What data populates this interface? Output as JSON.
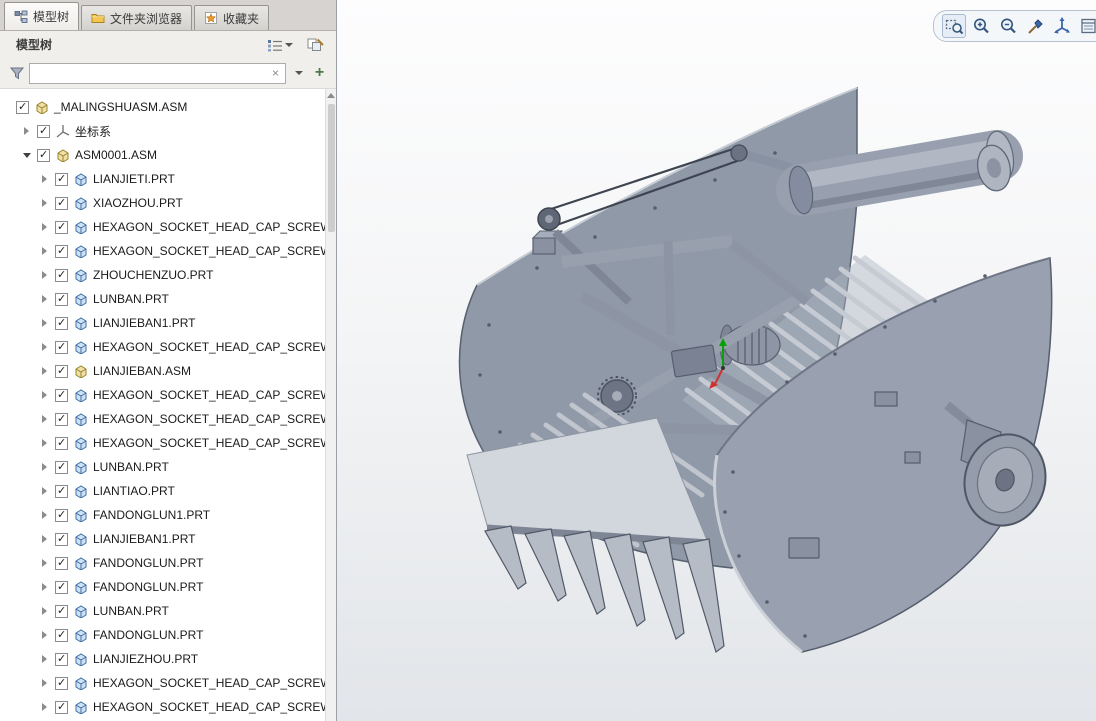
{
  "tabs": [
    {
      "label": "模型树",
      "icon": "model-tree-icon",
      "active": true
    },
    {
      "label": "文件夹浏览器",
      "icon": "folder-browser-icon",
      "active": false
    },
    {
      "label": "收藏夹",
      "icon": "favorites-icon",
      "active": false
    }
  ],
  "panel": {
    "title": "模型树",
    "icons": [
      "list-options-icon",
      "tree-settings-icon"
    ]
  },
  "filter": {
    "search_value": "",
    "placeholder": "",
    "clear_glyph": "×",
    "add_glyph": "+",
    "icons": [
      "filter-funnel-icon",
      "dropdown-caret-icon",
      "add-filter-icon"
    ]
  },
  "tree": {
    "items": [
      {
        "level": 0,
        "expander": "none",
        "checked": true,
        "icon": "asm",
        "label": "_MALINGSHUASM.ASM"
      },
      {
        "level": 1,
        "expander": "right",
        "checked": true,
        "icon": "coord",
        "label": "坐标系"
      },
      {
        "level": 1,
        "expander": "down",
        "checked": true,
        "icon": "asm",
        "label": "ASM0001.ASM"
      },
      {
        "level": 2,
        "expander": "right",
        "checked": true,
        "icon": "prt",
        "label": "LIANJIETI.PRT"
      },
      {
        "level": 2,
        "expander": "right",
        "checked": true,
        "icon": "prt",
        "label": "XIAOZHOU.PRT"
      },
      {
        "level": 2,
        "expander": "right",
        "checked": true,
        "icon": "prt",
        "label": "HEXAGON_SOCKET_HEAD_CAP_SCREW"
      },
      {
        "level": 2,
        "expander": "right",
        "checked": true,
        "icon": "prt",
        "label": "HEXAGON_SOCKET_HEAD_CAP_SCREW"
      },
      {
        "level": 2,
        "expander": "right",
        "checked": true,
        "icon": "prt",
        "label": "ZHOUCHENZUO.PRT"
      },
      {
        "level": 2,
        "expander": "right",
        "checked": true,
        "icon": "prt",
        "label": "LUNBAN.PRT"
      },
      {
        "level": 2,
        "expander": "right",
        "checked": true,
        "icon": "prt",
        "label": "LIANJIEBAN1.PRT"
      },
      {
        "level": 2,
        "expander": "right",
        "checked": true,
        "icon": "prt",
        "label": "HEXAGON_SOCKET_HEAD_CAP_SCREW"
      },
      {
        "level": 2,
        "expander": "right",
        "checked": true,
        "icon": "asm",
        "label": "LIANJIEBAN.ASM"
      },
      {
        "level": 2,
        "expander": "right",
        "checked": true,
        "icon": "prt",
        "label": "HEXAGON_SOCKET_HEAD_CAP_SCREW"
      },
      {
        "level": 2,
        "expander": "right",
        "checked": true,
        "icon": "prt",
        "label": "HEXAGON_SOCKET_HEAD_CAP_SCREW"
      },
      {
        "level": 2,
        "expander": "right",
        "checked": true,
        "icon": "prt",
        "label": "HEXAGON_SOCKET_HEAD_CAP_SCREW"
      },
      {
        "level": 2,
        "expander": "right",
        "checked": true,
        "icon": "prt",
        "label": "LUNBAN.PRT"
      },
      {
        "level": 2,
        "expander": "right",
        "checked": true,
        "icon": "prt",
        "label": "LIANTIAO.PRT"
      },
      {
        "level": 2,
        "expander": "right",
        "checked": true,
        "icon": "prt",
        "label": "FANDONGLUN1.PRT"
      },
      {
        "level": 2,
        "expander": "right",
        "checked": true,
        "icon": "prt",
        "label": "LIANJIEBAN1.PRT"
      },
      {
        "level": 2,
        "expander": "right",
        "checked": true,
        "icon": "prt",
        "label": "FANDONGLUN.PRT"
      },
      {
        "level": 2,
        "expander": "right",
        "checked": true,
        "icon": "prt",
        "label": "FANDONGLUN.PRT"
      },
      {
        "level": 2,
        "expander": "right",
        "checked": true,
        "icon": "prt",
        "label": "LUNBAN.PRT"
      },
      {
        "level": 2,
        "expander": "right",
        "checked": true,
        "icon": "prt",
        "label": "FANDONGLUN.PRT"
      },
      {
        "level": 2,
        "expander": "right",
        "checked": true,
        "icon": "prt",
        "label": "LIANJIEZHOU.PRT"
      },
      {
        "level": 2,
        "expander": "right",
        "checked": true,
        "icon": "prt",
        "label": "HEXAGON_SOCKET_HEAD_CAP_SCREW"
      },
      {
        "level": 2,
        "expander": "right",
        "checked": true,
        "icon": "prt",
        "label": "HEXAGON_SOCKET_HEAD_CAP_SCREW"
      }
    ]
  },
  "viewport": {
    "toolbar_icons": [
      "zoom-region",
      "zoom-in",
      "zoom-out",
      "repaint",
      "saved-orientations",
      "view-manager"
    ]
  },
  "colors": {
    "machine_gray": "#99a1b0",
    "machine_dark_edge": "#565e6d",
    "rod_light": "#c5cad3",
    "viewport_top": "#fdfdfe",
    "viewport_bottom": "#e2e5e9",
    "tab_bar_bg": "#d6d3d0",
    "triad_green": "#08a008",
    "triad_red": "#cf3030"
  }
}
